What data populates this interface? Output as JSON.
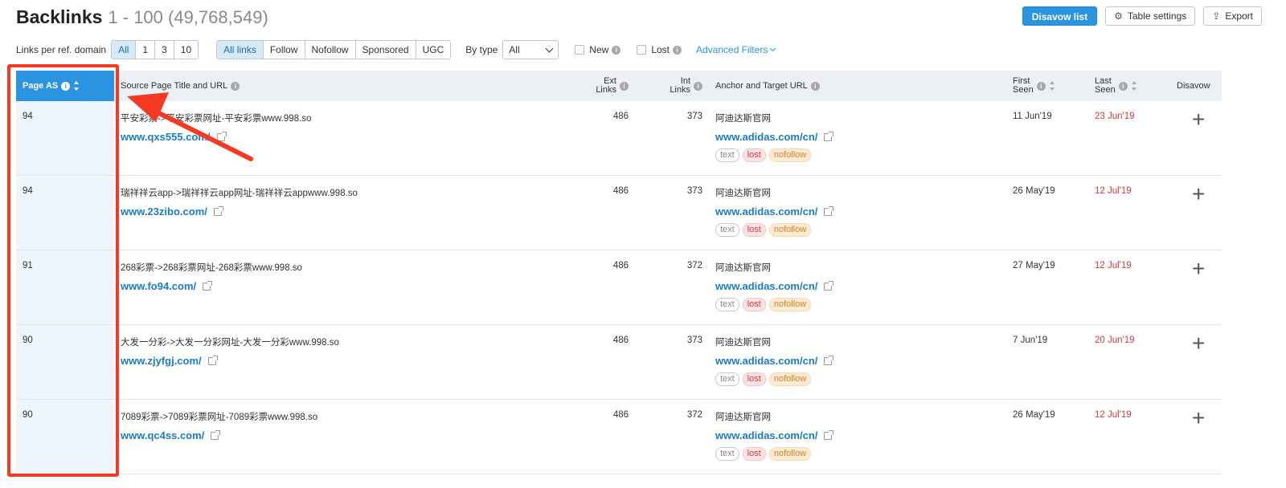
{
  "header": {
    "title": "Backlinks",
    "range": "1 - 100 (49,768,549)"
  },
  "actions": {
    "disavow_list": "Disavow list",
    "table_settings": "Table settings",
    "export": "Export",
    "table_settings_icon": "gear-icon",
    "export_icon": "upload-icon"
  },
  "filters": {
    "links_per_domain_label": "Links per ref. domain",
    "links_per_domain_options": [
      "All",
      "1",
      "3",
      "10"
    ],
    "link_type_options": [
      "All links",
      "Follow",
      "Nofollow",
      "Sponsored",
      "UGC"
    ],
    "by_type_label": "By type",
    "by_type_value": "All",
    "new_label": "New",
    "lost_label": "Lost",
    "advanced_filters": "Advanced Filters",
    "info_glyph": "i"
  },
  "columns": {
    "page_as": "Page AS",
    "source": "Source Page Title and URL",
    "ext_links_1": "Ext",
    "ext_links_2": "Links",
    "int_links_1": "Int",
    "int_links_2": "Links",
    "anchor": "Anchor and Target URL",
    "first_seen_1": "First",
    "first_seen_2": "Seen",
    "last_seen_1": "Last",
    "last_seen_2": "Seen",
    "disavow": "Disavow"
  },
  "rows": [
    {
      "page_as": "94",
      "source_title": "平安彩票->平安彩票网址-平安彩票www.998.so",
      "source_url": "www.qxs555.com/",
      "ext_links": "486",
      "int_links": "373",
      "anchor": "阿迪达斯官网",
      "target_url": "www.adidas.com/cn/",
      "tags": [
        "text",
        "lost",
        "nofollow"
      ],
      "first_seen": "11 Jun'19",
      "last_seen": "23 Jun'19"
    },
    {
      "page_as": "94",
      "source_title": "瑞祥祥云app->瑞祥祥云app网址-瑞祥祥云appwww.998.so",
      "source_url": "www.23zibo.com/",
      "ext_links": "486",
      "int_links": "373",
      "anchor": "阿迪达斯官网",
      "target_url": "www.adidas.com/cn/",
      "tags": [
        "text",
        "lost",
        "nofollow"
      ],
      "first_seen": "26 May'19",
      "last_seen": "12 Jul'19"
    },
    {
      "page_as": "91",
      "source_title": "268彩票->268彩票网址-268彩票www.998.so",
      "source_url": "www.fo94.com/",
      "ext_links": "486",
      "int_links": "372",
      "anchor": "阿迪达斯官网",
      "target_url": "www.adidas.com/cn/",
      "tags": [
        "text",
        "lost",
        "nofollow"
      ],
      "first_seen": "27 May'19",
      "last_seen": "12 Jul'19"
    },
    {
      "page_as": "90",
      "source_title": "大发一分彩->大发一分彩网址-大发一分彩www.998.so",
      "source_url": "www.zjyfgj.com/",
      "ext_links": "486",
      "int_links": "373",
      "anchor": "阿迪达斯官网",
      "target_url": "www.adidas.com/cn/",
      "tags": [
        "text",
        "lost",
        "nofollow"
      ],
      "first_seen": "7 Jun'19",
      "last_seen": "20 Jun'19"
    },
    {
      "page_as": "90",
      "source_title": "7089彩票->7089彩票网址-7089彩票www.998.so",
      "source_url": "www.qc4ss.com/",
      "ext_links": "486",
      "int_links": "372",
      "anchor": "阿迪达斯官网",
      "target_url": "www.adidas.com/cn/",
      "tags": [
        "text",
        "lost",
        "nofollow"
      ],
      "first_seen": "26 May'19",
      "last_seen": "12 Jul'19"
    }
  ],
  "disavow_glyph": "+",
  "colors": {
    "accent": "#2b94e1",
    "annotation": "#f53a24",
    "lost": "#d9383a",
    "nofollow": "#e07f1c"
  }
}
